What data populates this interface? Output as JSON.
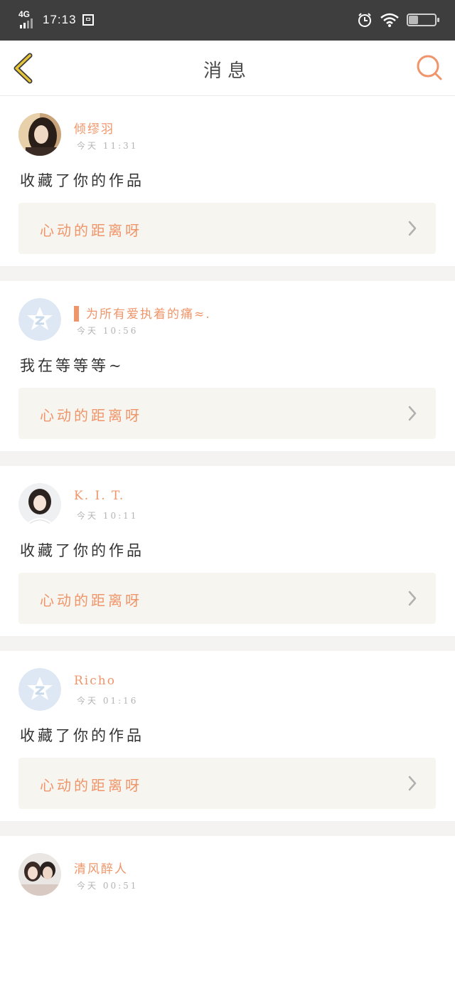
{
  "status_bar": {
    "network": "4G",
    "time": "17:13",
    "battery": "34",
    "battery_level": 0.34
  },
  "header": {
    "title": "消息",
    "back_icon": "chevron-left-icon",
    "search_icon": "search-icon"
  },
  "colors": {
    "accent": "#f0956a",
    "back_icon_yellow": "#e6c43a",
    "card_bg": "#f7f5ef",
    "separator": "#f4f3f1"
  },
  "messages": [
    {
      "name": "倾缪羽",
      "time": "今天 11:31",
      "text": "收藏了你的作品",
      "card_title": "心动的距离呀",
      "avatar": "photo-girl-dark"
    },
    {
      "name": "为所有爱执着的痛≈.",
      "time": "今天 10:56",
      "text": "我在等等等~",
      "card_title": "心动的距离呀",
      "avatar": "default-z-avatar"
    },
    {
      "name": "K. I. T.",
      "time": "今天 10:11",
      "text": "收藏了你的作品",
      "card_title": "心动的距离呀",
      "avatar": "photo-girl-light"
    },
    {
      "name": "Richo",
      "time": "今天 01:16",
      "text": "收藏了你的作品",
      "card_title": "心动的距离呀",
      "avatar": "default-z-avatar"
    },
    {
      "name": "清风醉人",
      "time": "今天 00:51",
      "avatar": "photo-couple"
    }
  ]
}
